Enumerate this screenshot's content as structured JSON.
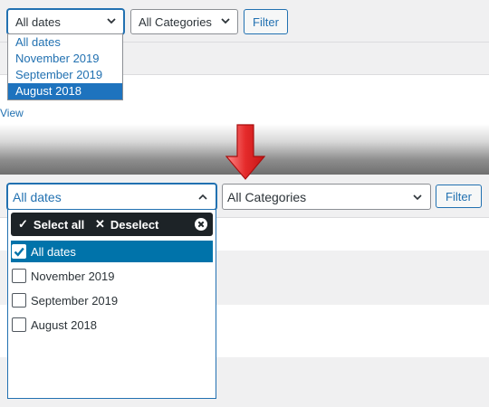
{
  "top": {
    "date_select": {
      "value": "All dates"
    },
    "category_select": {
      "value": "All Categories"
    },
    "filter_button": "Filter",
    "date_options": [
      {
        "label": "All dates",
        "selected": false
      },
      {
        "label": "November 2019",
        "selected": false
      },
      {
        "label": "September 2019",
        "selected": false
      },
      {
        "label": "August 2018",
        "selected": true
      }
    ],
    "view_link": "View"
  },
  "bottom": {
    "date_select": {
      "value": "All dates"
    },
    "category_select": {
      "value": "All Categories"
    },
    "filter_button": "Filter",
    "select_all": "Select all",
    "deselect": "Deselect",
    "options": [
      {
        "label": "All dates",
        "checked": true
      },
      {
        "label": "November 2019",
        "checked": false
      },
      {
        "label": "September 2019",
        "checked": false
      },
      {
        "label": "August 2018",
        "checked": false
      }
    ]
  },
  "icons": {
    "chevron": "chevron-down-icon",
    "arrow": "down-arrow-icon",
    "check": "checkmark-icon",
    "close": "close-circle-icon"
  },
  "colors": {
    "accent": "#2271b1",
    "selected_bg": "#0073aa",
    "toolbar_bg": "#1d2327",
    "arrow_red": "#e52b2b"
  }
}
